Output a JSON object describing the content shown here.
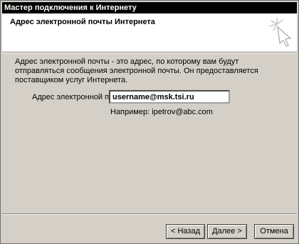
{
  "window": {
    "title": "Мастер подключения к Интернету"
  },
  "header": {
    "title": "Адрес электронной почты Интернета",
    "icon": "wizard-sparkle-icon"
  },
  "main": {
    "description": "Адрес электронной почты - это адрес, по которому вам будут отправляться сообщения электронной почты. Он предоставляется поставщиком услуг Интернета.",
    "email_label": "Адрес электронной почты:",
    "email_value": "username@msk.tsi.ru",
    "example": "Например: ipetrov@abc.com"
  },
  "footer": {
    "back_label": "< Назад",
    "next_label": "Далее >",
    "cancel_label": "Отмена"
  },
  "colors": {
    "dialog_bg": "#d4d0c8",
    "header_bg": "#ffffff",
    "titlebar_bg": "#000000"
  }
}
